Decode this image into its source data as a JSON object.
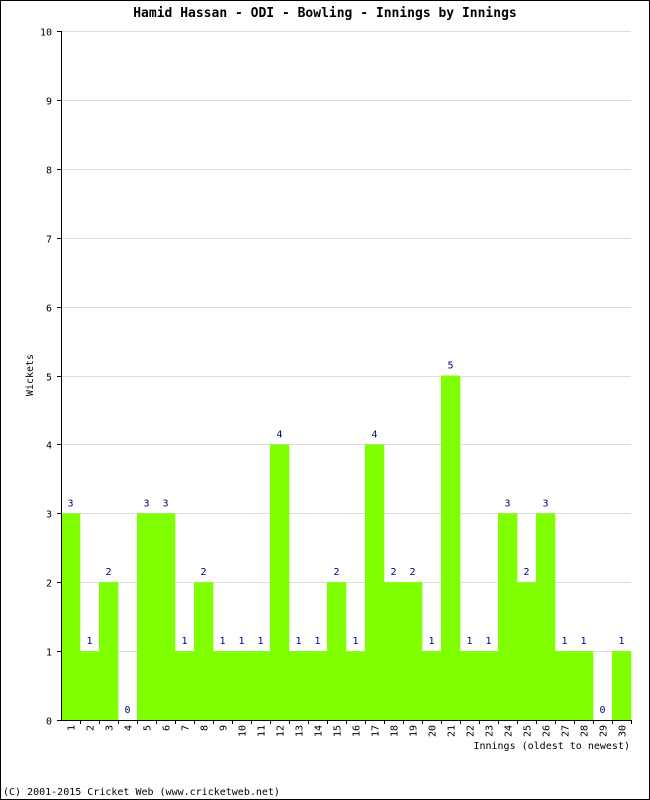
{
  "chart_data": {
    "type": "bar",
    "title": "Hamid Hassan - ODI - Bowling - Innings by Innings",
    "xlabel": "Innings (oldest to newest)",
    "ylabel": "Wickets",
    "ylim": [
      0,
      10
    ],
    "yticks": [
      0,
      1,
      2,
      3,
      4,
      5,
      6,
      7,
      8,
      9,
      10
    ],
    "grid": true,
    "categories": [
      "1",
      "2",
      "3",
      "4",
      "5",
      "6",
      "7",
      "8",
      "9",
      "10",
      "11",
      "12",
      "13",
      "14",
      "15",
      "16",
      "17",
      "18",
      "19",
      "20",
      "21",
      "22",
      "23",
      "24",
      "25",
      "26",
      "27",
      "28",
      "29",
      "30"
    ],
    "values": [
      3,
      1,
      2,
      0,
      3,
      3,
      1,
      2,
      1,
      1,
      1,
      4,
      1,
      1,
      2,
      1,
      4,
      2,
      2,
      1,
      5,
      1,
      1,
      3,
      2,
      3,
      1,
      1,
      0,
      1
    ],
    "bar_color": "#80ff00",
    "label_color": "#000080",
    "footer": "(C) 2001-2015 Cricket Web (www.cricketweb.net)"
  }
}
